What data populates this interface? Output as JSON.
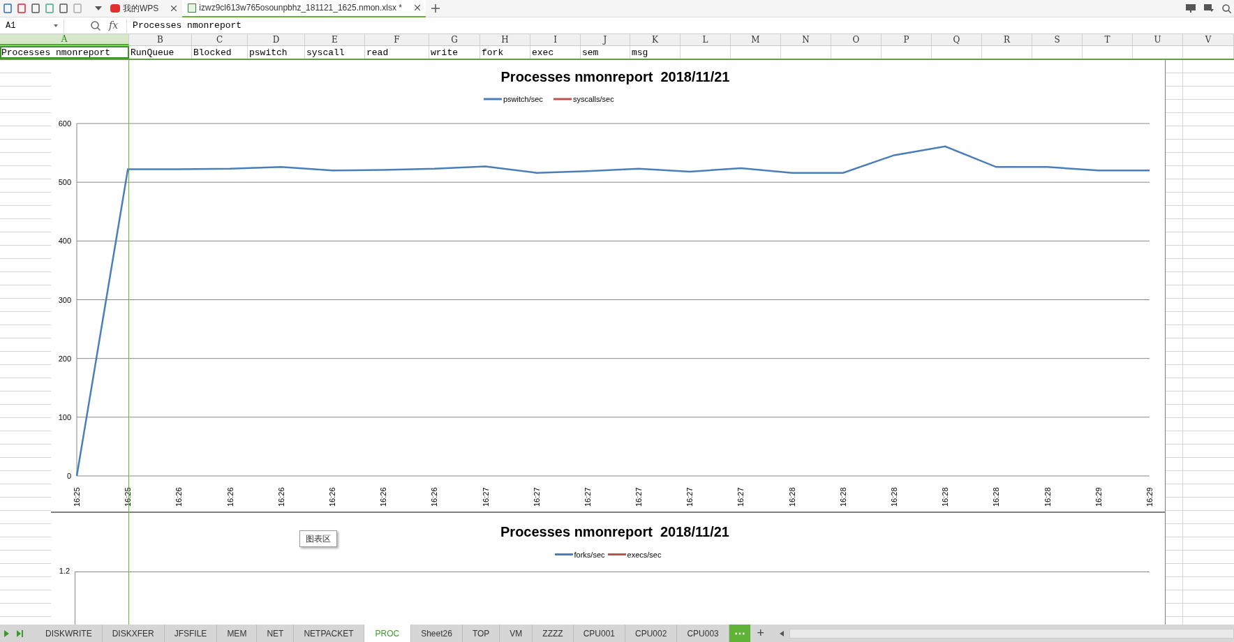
{
  "toolbar": {
    "doc_tabs": [
      {
        "label": "我的WPS",
        "selected": false,
        "kind": "wps"
      },
      {
        "label": "izwz9cl613w765osounpbhz_181121_1625.nmon.xlsx *",
        "selected": true,
        "kind": "file"
      }
    ]
  },
  "formula_bar": {
    "cell": "A1",
    "fx": "fx",
    "value": "Processes nmonreport"
  },
  "columns": [
    {
      "label": "A",
      "selected": true
    },
    {
      "label": "B",
      "selected": false
    },
    {
      "label": "C",
      "selected": false
    },
    {
      "label": "D",
      "selected": false
    },
    {
      "label": "E",
      "selected": false
    },
    {
      "label": "F",
      "selected": false
    },
    {
      "label": "G",
      "selected": false
    },
    {
      "label": "H",
      "selected": false
    },
    {
      "label": "I",
      "selected": false
    },
    {
      "label": "J",
      "selected": false
    },
    {
      "label": "K",
      "selected": false
    },
    {
      "label": "L",
      "selected": false
    },
    {
      "label": "M",
      "selected": false
    },
    {
      "label": "N",
      "selected": false
    },
    {
      "label": "O",
      "selected": false
    },
    {
      "label": "P",
      "selected": false
    },
    {
      "label": "Q",
      "selected": false
    },
    {
      "label": "R",
      "selected": false
    },
    {
      "label": "S",
      "selected": false
    },
    {
      "label": "T",
      "selected": false
    },
    {
      "label": "U",
      "selected": false
    },
    {
      "label": "V",
      "selected": false
    }
  ],
  "row_1": [
    "Processes nmonreport",
    "RunQueue",
    "Blocked",
    "pswitch",
    "syscall",
    "read",
    "write",
    "fork",
    "exec",
    "sem",
    "msg"
  ],
  "chart_1": {
    "chart_data": {
      "type": "line",
      "title": "Processes nmonreport  2018/11/21",
      "categories": [
        "16:25",
        "16:25",
        "16:26",
        "16:26",
        "16:26",
        "16:26",
        "16:26",
        "16:26",
        "16:27",
        "16:27",
        "16:27",
        "16:27",
        "16:27",
        "16:27",
        "16:28",
        "16:28",
        "16:28",
        "16:28",
        "16:28",
        "16:28",
        "16:29",
        "16:29"
      ],
      "series": [
        {
          "name": "pswitch/sec",
          "color": "#4a7ebb",
          "values": [
            0,
            522,
            522,
            523,
            526,
            520,
            521,
            523,
            527,
            516,
            519,
            523,
            518,
            524,
            516,
            516,
            546,
            561,
            526,
            526,
            520,
            520
          ]
        },
        {
          "name": "syscalls/sec",
          "color": "#c0504d",
          "values": [
            null,
            null,
            null,
            null,
            null,
            null,
            null,
            null,
            null,
            null,
            null,
            null,
            null,
            null,
            null,
            null,
            null,
            null,
            null,
            null,
            null,
            null
          ]
        }
      ],
      "grid": true,
      "ylim": [
        0,
        600
      ],
      "yticks": [
        0,
        100,
        200,
        300,
        400,
        500,
        600
      ]
    }
  },
  "chart_2": {
    "title": "Processes nmonreport  2018/11/21",
    "legend": [
      {
        "name": "forks/sec",
        "color": "#4a7ebb"
      },
      {
        "name": "execs/sec",
        "color": "#c0504d"
      }
    ],
    "y_axis_label": "1.2"
  },
  "tooltip": "图表区",
  "sheet_tabs": [
    {
      "label": "DISKWRITE",
      "selected": false
    },
    {
      "label": "DISKXFER",
      "selected": false
    },
    {
      "label": "JFSFILE",
      "selected": false
    },
    {
      "label": "MEM",
      "selected": false
    },
    {
      "label": "NET",
      "selected": false
    },
    {
      "label": "NETPACKET",
      "selected": false
    },
    {
      "label": "PROC",
      "selected": true
    },
    {
      "label": "Sheet26",
      "selected": false
    },
    {
      "label": "TOP",
      "selected": false
    },
    {
      "label": "VM",
      "selected": false
    },
    {
      "label": "ZZZZ",
      "selected": false
    },
    {
      "label": "CPU001",
      "selected": false
    },
    {
      "label": "CPU002",
      "selected": false
    },
    {
      "label": "CPU003",
      "selected": false
    }
  ],
  "more_tabs": "⋯",
  "add_tab": "+"
}
